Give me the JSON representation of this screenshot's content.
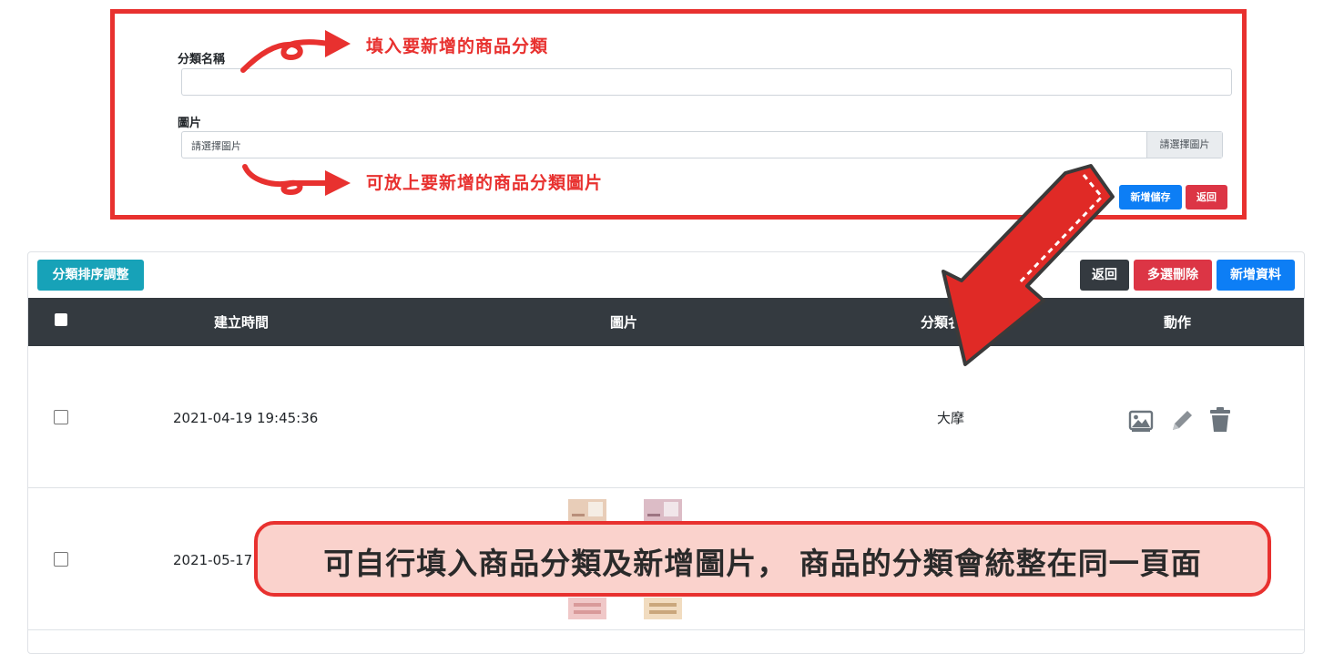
{
  "form": {
    "name_label": "分類名稱",
    "name_value": "",
    "image_label": "圖片",
    "file_placeholder": "請選擇圖片",
    "file_button": "請選擇圖片",
    "save_button": "新增儲存",
    "back_button": "返回"
  },
  "annotations": {
    "note_name": "填入要新增的商品分類",
    "note_image": "可放上要新增的商品分類圖片",
    "callout": "可自行填入商品分類及新增圖片， 商品的分類會統整在同一頁面"
  },
  "toolbar": {
    "sort_button": "分類排序調整",
    "back_button": "返回",
    "bulk_delete_button": "多選刪除",
    "add_button": "新增資料"
  },
  "table": {
    "columns": [
      "建立時間",
      "圖片",
      "分類名",
      "動作"
    ],
    "rows": [
      {
        "created": "2021-04-19 19:45:36",
        "category": "大摩",
        "has_image": false
      },
      {
        "created": "2021-05-17",
        "category": "",
        "has_image": true
      }
    ]
  },
  "icons": {
    "view_image": "image-icon",
    "edit": "pencil-icon",
    "delete": "trash-icon"
  },
  "colors": {
    "highlight_red": "#e8312f",
    "header_dark": "#343a40",
    "primary": "#0d7ef5",
    "danger": "#dc3545",
    "info": "#17a2b8",
    "callout_bg": "#fad2cc"
  }
}
